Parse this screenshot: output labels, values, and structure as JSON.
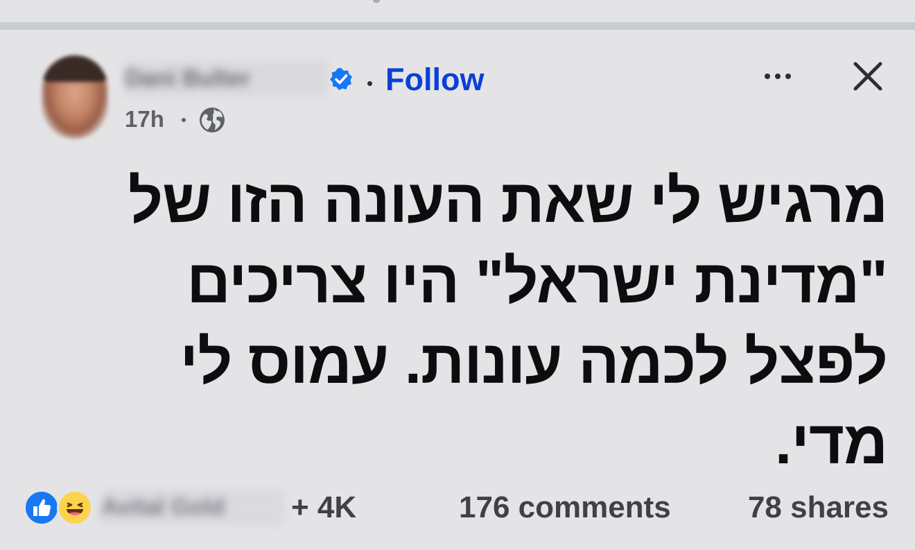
{
  "colors": {
    "background": "#e4e4e6",
    "divider": "#c8cbd3",
    "follow": "#0a3fd8",
    "verified": "#1877f2",
    "text": "#0d0d0f",
    "secondary_text": "#3f4148"
  },
  "header": {
    "author_name": "Dani Bulter",
    "verified_icon": "verified-badge-icon",
    "follow_label": "Follow",
    "more_icon": "more-horizontal-icon",
    "close_icon": "close-icon",
    "timestamp": "17h",
    "audience_icon": "globe-icon"
  },
  "post": {
    "text": "מרגיש לי שאת העונה הזו של \"מדינת ישראל\" היו צריכים לפצל לכמה עונות. עמוס לי מדי."
  },
  "footer": {
    "reaction_icons": [
      "like-icon",
      "haha-icon"
    ],
    "reactors_names": "Avital Gold",
    "reactions_count": "+ 4K",
    "comments": "176 comments",
    "shares": "78 shares"
  }
}
